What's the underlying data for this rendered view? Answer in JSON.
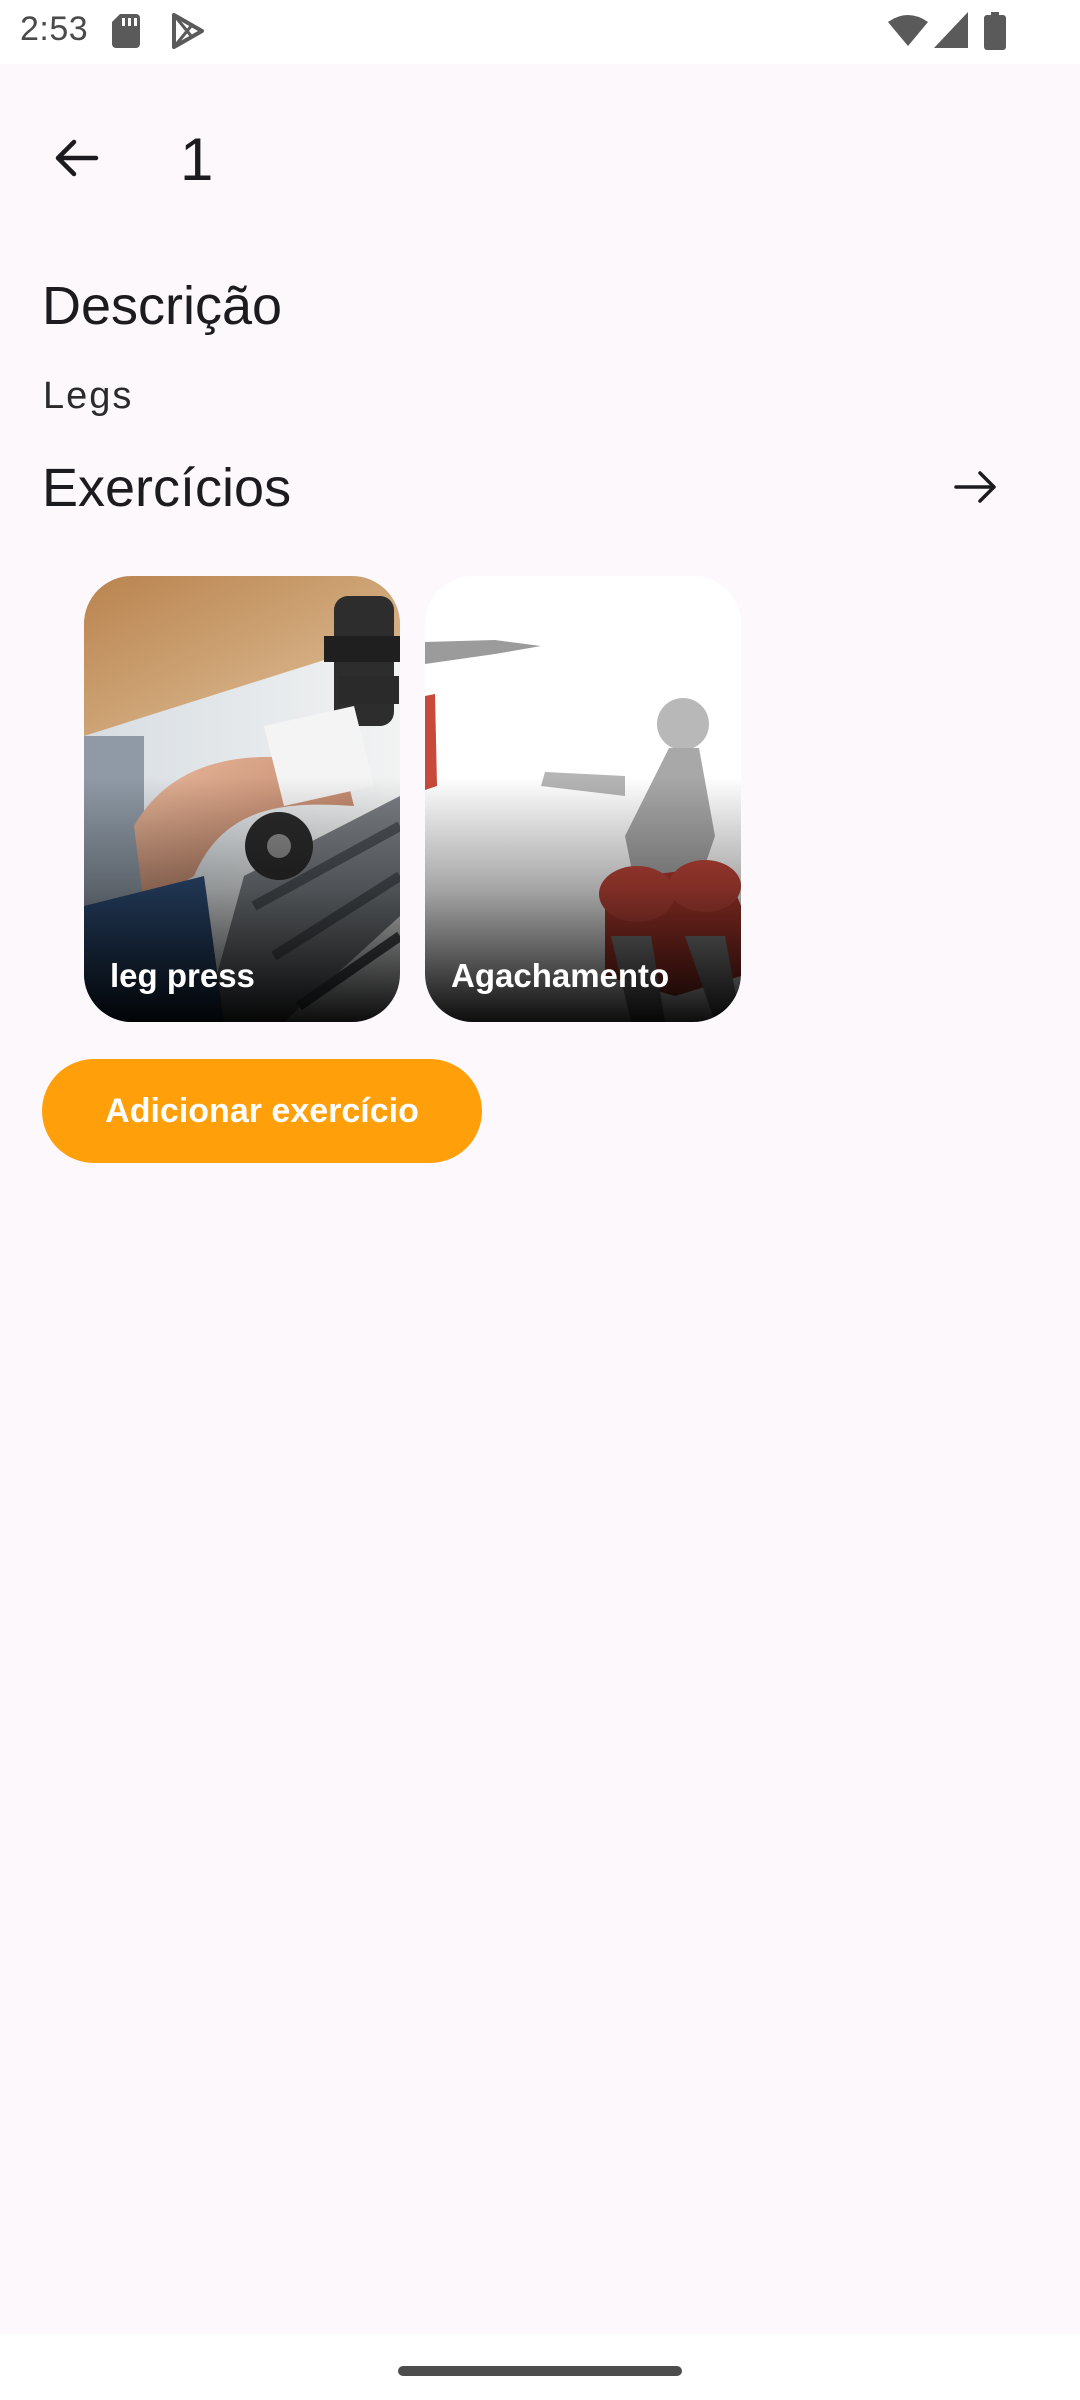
{
  "status_bar": {
    "time": "2:53",
    "icons": [
      "sd-card-icon",
      "play-store-icon",
      "wifi-icon",
      "signal-icon",
      "battery-icon"
    ]
  },
  "app_bar": {
    "back_icon": "arrow-back-icon",
    "title": "1"
  },
  "description": {
    "heading": "Descrição",
    "value": "Legs"
  },
  "exercises": {
    "heading": "Exercícios",
    "more_icon": "arrow-forward-icon",
    "cards": [
      {
        "label": "leg press",
        "image": "leg-press-photo"
      },
      {
        "label": "Agachamento",
        "image": "squat-illustration"
      }
    ]
  },
  "add_button": {
    "label": "Adicionar exercício",
    "color": "#ff9f0a"
  },
  "colors": {
    "background": "#fcf8fc",
    "text": "#1c1b1f",
    "accent": "#ff9f0a"
  }
}
